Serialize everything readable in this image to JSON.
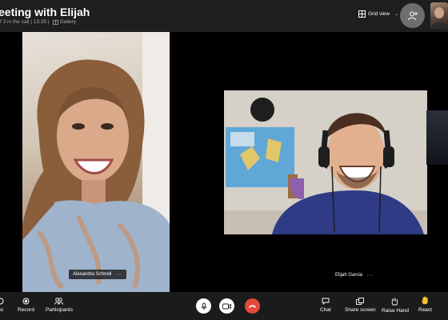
{
  "header": {
    "title": "eeting with Elijah",
    "call_info": "f 3 in the call | 13:35 |",
    "gallery_label": "Gallery",
    "view_label": "Grid view"
  },
  "participants": [
    {
      "name": "Alexandra Schnell"
    },
    {
      "name": "Elijah Garcia"
    }
  ],
  "tile_menu": "···",
  "toolbar": {
    "left": [
      {
        "label": "ite",
        "icon": "invite-icon"
      },
      {
        "label": "Record",
        "icon": "record-icon"
      },
      {
        "label": "Participants",
        "icon": "participants-icon"
      }
    ],
    "center": [
      {
        "icon": "microphone-icon"
      },
      {
        "icon": "camera-icon"
      },
      {
        "icon": "end-call-icon",
        "color": "#e24a3b"
      }
    ],
    "right": [
      {
        "label": "Chat",
        "icon": "chat-icon"
      },
      {
        "label": "Share screen",
        "icon": "share-screen-icon"
      },
      {
        "label": "Raise Hand",
        "icon": "raise-hand-icon"
      },
      {
        "label": "React",
        "icon": "react-icon"
      }
    ]
  }
}
